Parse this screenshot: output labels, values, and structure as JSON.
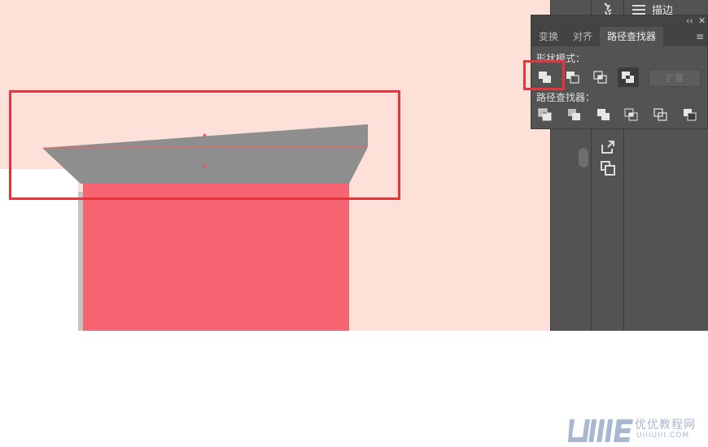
{
  "panel": {
    "tabs": [
      {
        "label": "变换"
      },
      {
        "label": "对齐"
      },
      {
        "label": "路径查找器",
        "active": true
      }
    ],
    "shape_modes_label": "形状模式：",
    "expand_label": "扩展",
    "pathfinders_label": "路径查找器：",
    "collapse_icon": "‹‹",
    "close_icon": "✕",
    "menu_icon": "≡"
  },
  "dock": {
    "stroke_label": "描边"
  },
  "watermark": {
    "cn": "优优教程网",
    "en": "UIIIUIII.COM"
  },
  "colors": {
    "canvas": "#fde0d8",
    "shape_red": "#f66471",
    "shape_grey": "#8e8e8e",
    "highlight": "#e8343d",
    "panel_bg": "#535353"
  }
}
